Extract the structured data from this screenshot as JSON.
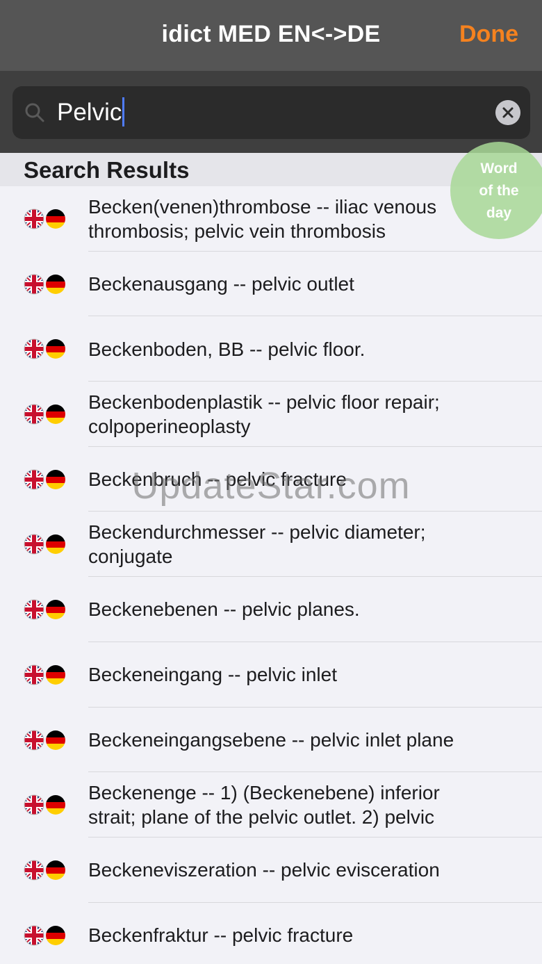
{
  "navbar": {
    "title": "idict MED EN<->DE",
    "done_label": "Done"
  },
  "search": {
    "value": "Pelvic"
  },
  "section": {
    "title": "Search Results"
  },
  "word_of_the_day": {
    "line1": "Word",
    "line2": "of the",
    "line3": "day"
  },
  "results": [
    {
      "text": "Becken(venen)thrombose -- iliac venous thrombosis; pelvic vein thrombosis"
    },
    {
      "text": "Beckenausgang -- pelvic outlet"
    },
    {
      "text": "Beckenboden, BB -- pelvic floor."
    },
    {
      "text": "Beckenbodenplastik -- pelvic floor repair; colpoperineoplasty"
    },
    {
      "text": "Beckenbruch -- pelvic fracture"
    },
    {
      "text": "Beckendurchmesser -- pelvic diameter; conjugate"
    },
    {
      "text": "Beckenebenen -- pelvic planes."
    },
    {
      "text": "Beckeneingang -- pelvic inlet"
    },
    {
      "text": "Beckeneingangsebene -- pelvic inlet plane"
    },
    {
      "text": "Beckenenge -- 1) (Beckenebene) inferior strait; plane of the pelvic outlet. 2) pelvic"
    },
    {
      "text": "Beckeneviszeration -- pelvic evisceration"
    },
    {
      "text": "Beckenfraktur -- pelvic fracture"
    }
  ],
  "watermark": "UpdateStar.com",
  "colors": {
    "accent": "#f5821f",
    "navbar": "#555555",
    "search_bg": "#3f3f3f",
    "wotd": "#a8d896"
  }
}
